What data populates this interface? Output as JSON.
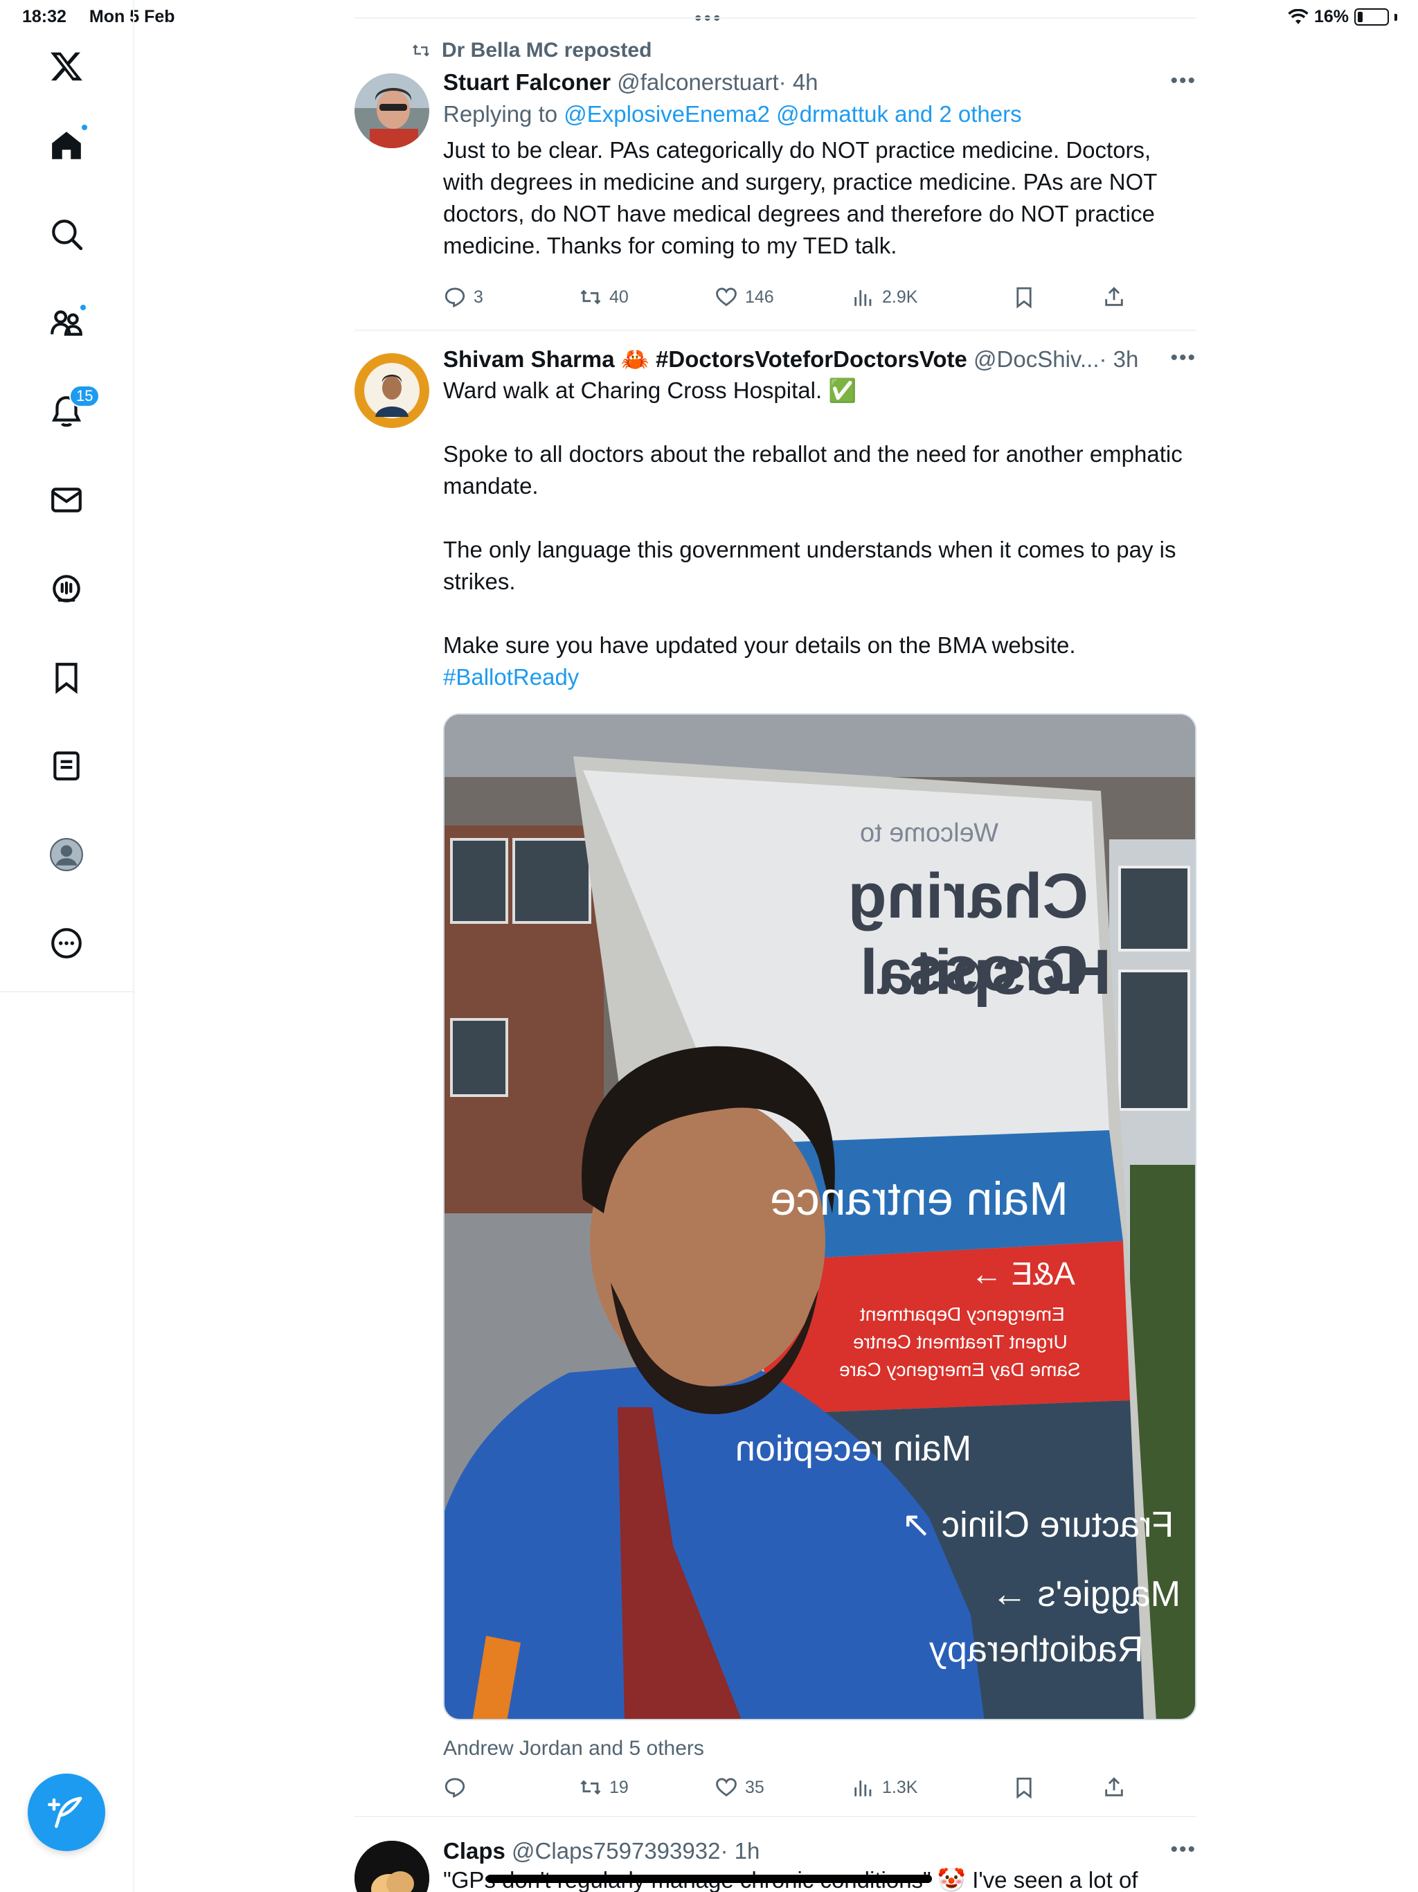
{
  "status_bar": {
    "time": "18:32",
    "date": "Mon 5 Feb",
    "battery": "16%"
  },
  "sidebar": {
    "items": [
      {
        "name": "x-logo"
      },
      {
        "name": "home"
      },
      {
        "name": "search"
      },
      {
        "name": "communities"
      },
      {
        "name": "notifications",
        "badge": "15"
      },
      {
        "name": "messages"
      },
      {
        "name": "spaces"
      },
      {
        "name": "bookmarks"
      },
      {
        "name": "lists"
      },
      {
        "name": "profile"
      },
      {
        "name": "more"
      }
    ]
  },
  "tweets": [
    {
      "repost_label": "Dr Bella MC reposted",
      "name": "Stuart Falconer",
      "handle": "@falconerstuart",
      "time": "· 4h",
      "replying_prefix": "Replying to",
      "replying_mentions": "@ExplosiveEnema2 @drmattuk and 2 others",
      "text": "Just to be clear. PAs categorically do NOT practice medicine. Doctors, with degrees in medicine and surgery, practice medicine. PAs are NOT doctors, do NOT have medical degrees and therefore do NOT practice medicine. Thanks for coming to my TED talk.",
      "replies": "3",
      "reposts": "40",
      "likes": "146",
      "views": "2.9K"
    },
    {
      "name": "Shivam Sharma 🦀 #DoctorsVoteforDoctorsVote",
      "handle": "@DocShiv...",
      "time": "· 3h",
      "text": "Ward walk at Charing Cross Hospital. ✅\n\nSpoke to all doctors about the reballot and the need for another emphatic mandate.\n\nThe only language this government understands when it comes to pay is strikes.\n\nMake sure you have updated your details on the BMA website.",
      "hashtag": "#BallotReady",
      "photo_sign": {
        "welcome": "Welcome to",
        "title_line1": "Charing Cross",
        "title_line2": "Hospital",
        "main_entrance": "Main entrance",
        "ae": "A&E →",
        "ae_sub1": "Emergency Department",
        "ae_sub2": "Urgent Treatment Centre",
        "ae_sub3": "Same Day Emergency Care",
        "reception": "Main reception",
        "fracture": "Fracture Clinic ↗",
        "maggies": "Maggie's →",
        "radiotherapy": "Radiotherapy"
      },
      "social_context": "Andrew Jordan and 5 others",
      "replies": "",
      "reposts": "19",
      "likes": "35",
      "views": "1.3K"
    },
    {
      "name": "Claps",
      "handle": "@Claps7597393932",
      "time": "· 1h",
      "text": "\"GPs don't regularly manage chronic conditions\" 🤡 I've seen a lot of"
    }
  ],
  "colors": {
    "accent": "#1d9bf0",
    "text": "#0f1419",
    "secondary": "#536471",
    "divider": "#eff3f4"
  }
}
